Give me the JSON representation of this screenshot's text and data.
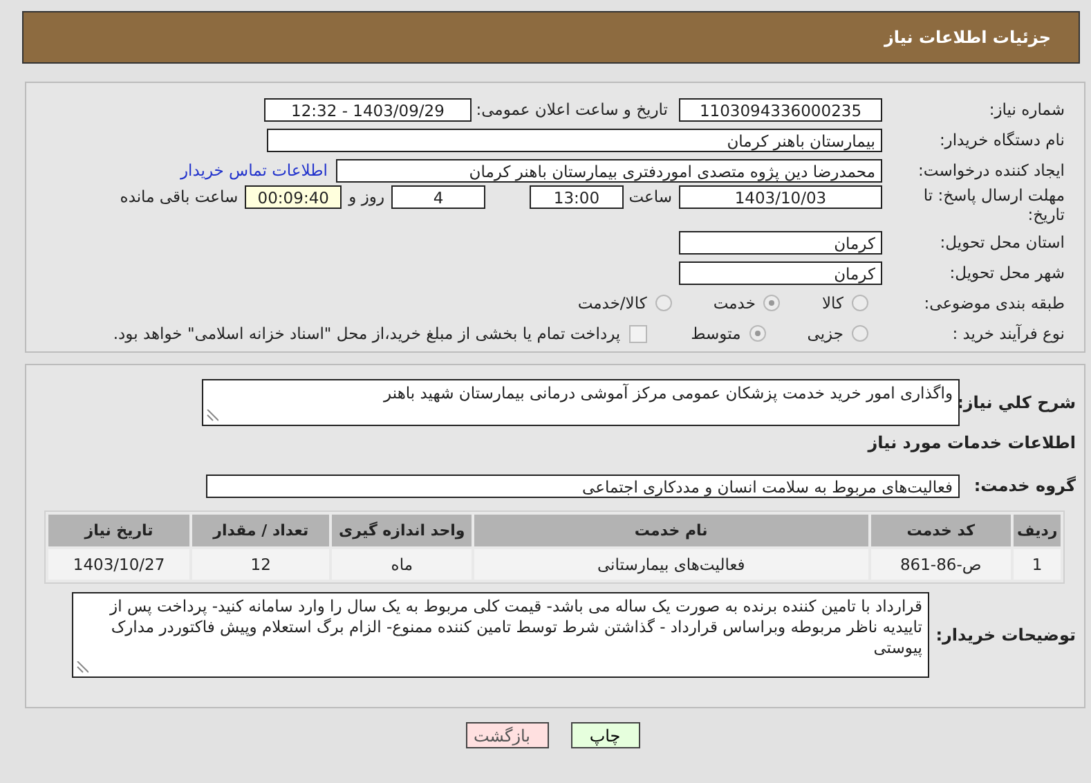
{
  "header": {
    "title": "جزئیات اطلاعات نیاز"
  },
  "need_number": {
    "label": "شماره نیاز:",
    "value": "1103094336000235"
  },
  "announce": {
    "label": "تاریخ و ساعت اعلان عمومی:",
    "value": "1403/09/29 - 12:32"
  },
  "buyer": {
    "label": "نام دستگاه خریدار:",
    "value": "بیمارستان باهنر کرمان"
  },
  "creator": {
    "label": "ایجاد کننده درخواست:",
    "value": "محمدرضا  دین پژوه متصدی اموردفتری بیمارستان باهنر کرمان",
    "link": "اطلاعات تماس خریدار"
  },
  "deadline": {
    "label": "مهلت ارسال پاسخ: تا تاریخ:",
    "date": "1403/10/03",
    "time_label": "ساعت",
    "time": "13:00",
    "days": "4",
    "days_label": "روز و",
    "remaining": "00:09:40",
    "remaining_label": "ساعت باقی مانده"
  },
  "province": {
    "label": "استان محل تحویل:",
    "value": "کرمان"
  },
  "city": {
    "label": "شهر محل تحویل:",
    "value": "کرمان"
  },
  "category": {
    "label": "طبقه بندی موضوعی:",
    "options": [
      {
        "label": "کالا",
        "selected": false
      },
      {
        "label": "خدمت",
        "selected": true
      },
      {
        "label": "کالا/خدمت",
        "selected": false
      }
    ]
  },
  "process": {
    "label": "نوع فرآیند خرید :",
    "options": [
      {
        "label": "جزیی",
        "selected": false
      },
      {
        "label": "متوسط",
        "selected": true
      }
    ],
    "treasury": {
      "label": "پرداخت تمام یا بخشی از مبلغ خرید،از محل \"اسناد خزانه اسلامی\" خواهد بود.",
      "checked": false
    }
  },
  "summary": {
    "label": "شرح کلي نياز:",
    "value": "واگذاری امور خرید خدمت پزشکان عمومی مرکز آموشی درمانی بیمارستان شهید باهنر"
  },
  "services_heading": "اطلاعات خدمات مورد نیاز",
  "service_group": {
    "label": "گروه خدمت:",
    "value": "فعالیت‌های مربوط به سلامت انسان و مددکاری اجتماعی"
  },
  "table": {
    "columns": [
      "ردیف",
      "کد خدمت",
      "نام خدمت",
      "واحد اندازه گیری",
      "تعداد / مقدار",
      "تاریخ نیاز"
    ],
    "rows": [
      [
        "1",
        "ص-86-861",
        "فعالیت‌های بیمارستانی",
        "ماه",
        "12",
        "1403/10/27"
      ]
    ]
  },
  "buyer_notes": {
    "label": "توضیحات خریدار:",
    "value": "قرارداد با تامین کننده برنده به صورت یک ساله می باشد- قیمت کلی مربوط به یک سال را وارد سامانه کنید- پرداخت پس از تاییدیه ناظر مربوطه وبراساس قرارداد - گذاشتن شرط توسط تامین کننده ممنوع- الزام برگ استعلام وپیش فاکتوردر مدارک پیوستی"
  },
  "buttons": [
    {
      "label": "چاپ",
      "kind": "print"
    },
    {
      "label": "بازگشت",
      "kind": "back"
    }
  ]
}
